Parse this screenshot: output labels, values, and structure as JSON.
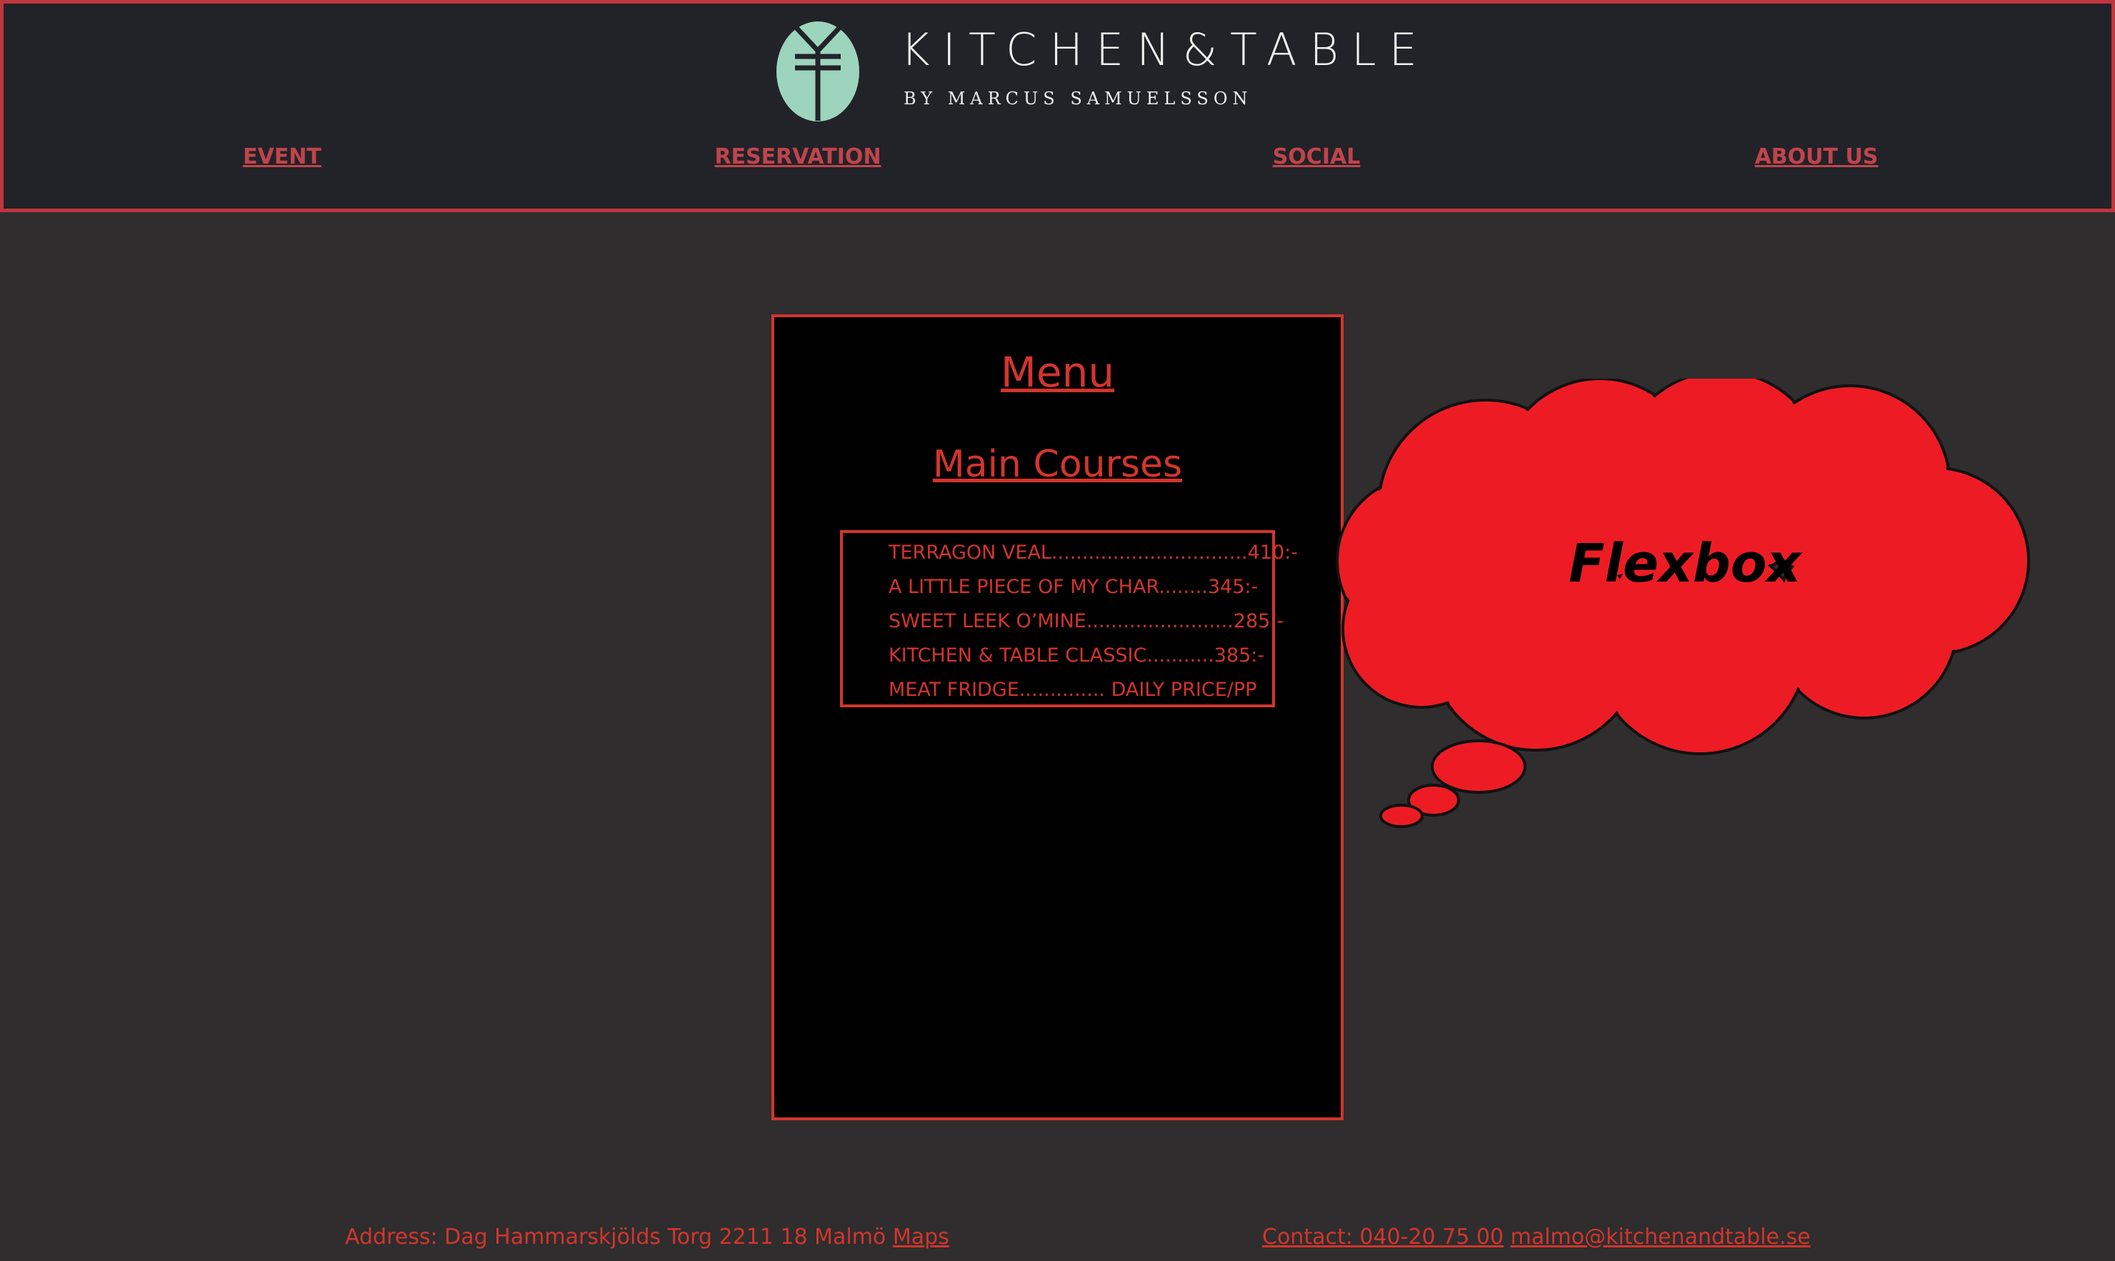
{
  "header": {
    "brand_title": "KITCHEN&TABLE",
    "brand_subtitle": "BY MARCUS SAMUELSSON",
    "nav": [
      {
        "label": "EVENT"
      },
      {
        "label": "RESERVATION"
      },
      {
        "label": "SOCIAL"
      },
      {
        "label": "ABOUT US"
      }
    ]
  },
  "menu": {
    "title": "Menu",
    "section": "Main Courses",
    "items": [
      {
        "text": "TERRAGON VEAL................................410:-"
      },
      {
        "text": "A LITTLE PIECE OF MY CHAR........345:-"
      },
      {
        "text": "SWEET LEEK O’MINE........................285:-"
      },
      {
        "text": "KITCHEN & TABLE CLASSIC...........385:-"
      },
      {
        "text": "MEAT FRIDGE.............. DAILY PRICE/PP"
      }
    ]
  },
  "callout": {
    "text": "Flexbox",
    "color": "#ed1c24"
  },
  "footer": {
    "address": "Address: Dag Hammarskjölds Torg 2211 18 Malmö",
    "maps_link": "Maps",
    "contact_link": "Contact: 040-20 75 00",
    "email_link": "malmo@kitchenandtable.se"
  },
  "colors": {
    "accent": "#d2352c",
    "header_bg": "#222328",
    "page_bg": "#2f2d2e",
    "logo_mint": "#9dd4bd"
  }
}
